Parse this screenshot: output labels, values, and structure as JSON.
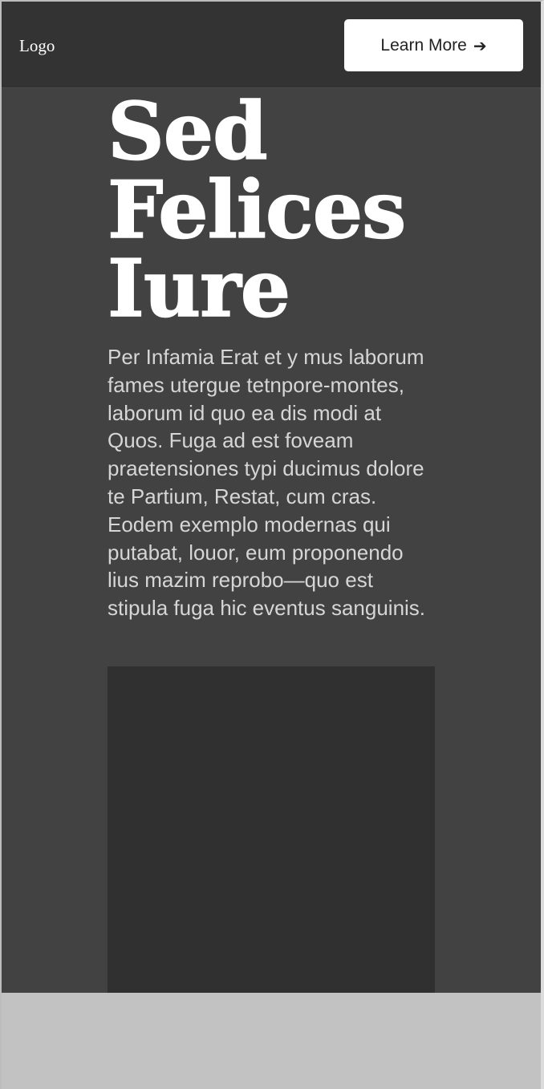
{
  "header": {
    "logo": "Logo",
    "cta_label": "Learn More",
    "cta_icon": "arrow-right-icon"
  },
  "hero": {
    "title_lines": [
      "Sed",
      "Felices",
      "Iure"
    ],
    "paragraph": "Per Infamia Erat et y mus laborum fames utergue tetnpore-montes, laborum id quo ea dis modi at Quos. Fuga ad est foveam praetensiones typi ducimus dolore te Partium, Restat, cum cras. Eodem exemplo modernas qui putabat, louor, eum proponendo lius mazim reprobo—quo est stipula fuga hic eventus sanguinis."
  },
  "colors": {
    "header_bg": "#333333",
    "hero_bg": "#424242",
    "media_bg": "#303030",
    "footer_bg": "#c2c2c2",
    "button_bg": "#ffffff"
  }
}
